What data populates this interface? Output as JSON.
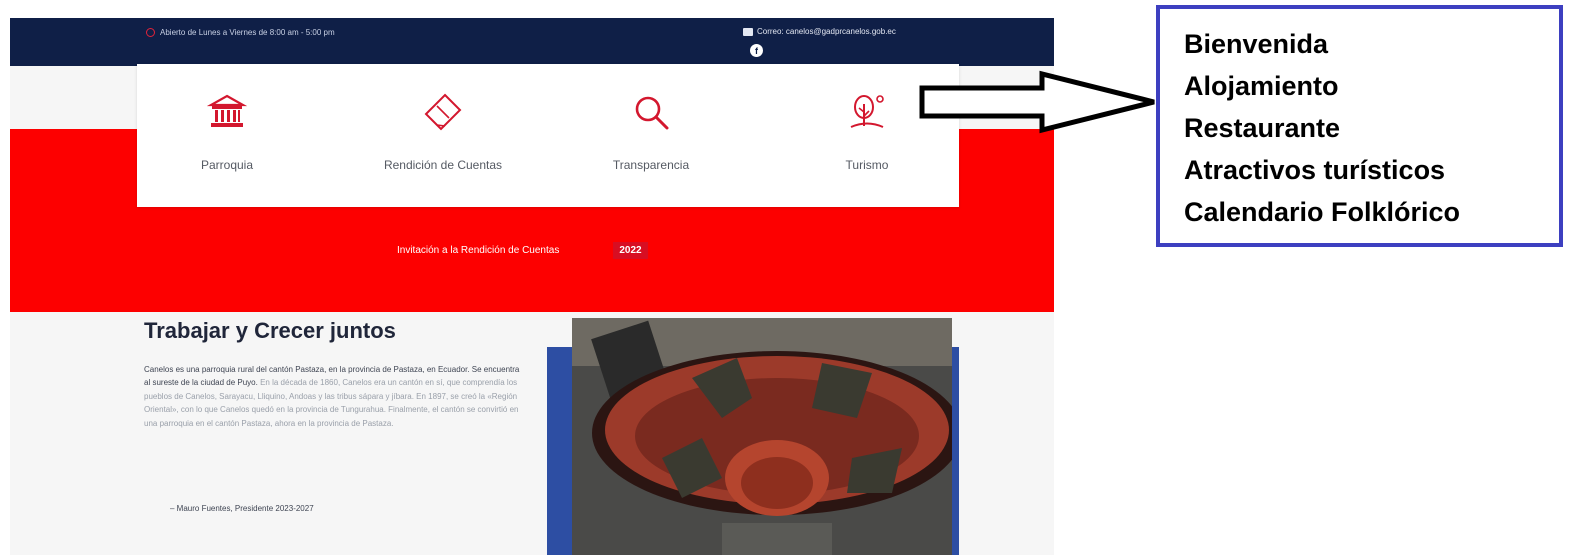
{
  "topbar": {
    "hours": "Abierto de Lunes a Viernes de 8:00 am - 5:00 pm",
    "contact": "Correo: canelos@gadprcanelos.gob.ec",
    "facebook_icon": "facebook-icon",
    "colors": {
      "background": "#0f1f47",
      "accent": "#e0233a"
    }
  },
  "nav": {
    "items": [
      {
        "label": "Parroquia",
        "icon": "building-icon"
      },
      {
        "label": "Rendición de Cuentas",
        "icon": "book-icon"
      },
      {
        "label": "Transparencia",
        "icon": "search-icon"
      },
      {
        "label": "Turismo",
        "icon": "tree-sun-icon"
      }
    ],
    "icon_color": "#d3172e"
  },
  "banner": {
    "text": "Invitación a la Rendición de Cuentas",
    "year": "2022",
    "color": "#fd0000"
  },
  "content": {
    "title": "Trabajar y Crecer juntos",
    "paragraph_strong": "Canelos es una parroquia rural del cantón Pastaza, en la provincia de Pastaza, en Ecuador. Se encuentra al sureste de la ciudad de Puyo.",
    "paragraph_rest": "En la década de 1860, Canelos era un cantón en sí, que comprendía los pueblos de Canelos, Sarayacu, Lliquino, Andoas y las tribus sápara y jíbara. En 1897, se creó la «Región Oriental», con lo que Canelos quedó en la provincia de Tungurahua. Finalmente, el cantón se convirtió en una parroquia en el cantón Pastaza, ahora en la provincia de Pastaza.",
    "signature": "– Mauro Fuentes, Presidente 2023-2027"
  },
  "annotation": {
    "items": [
      "Bienvenida",
      "Alojamiento",
      "Restaurante",
      "Atractivos turísticos",
      "Calendario Folklórico"
    ],
    "border_color": "#3d3fc0"
  }
}
